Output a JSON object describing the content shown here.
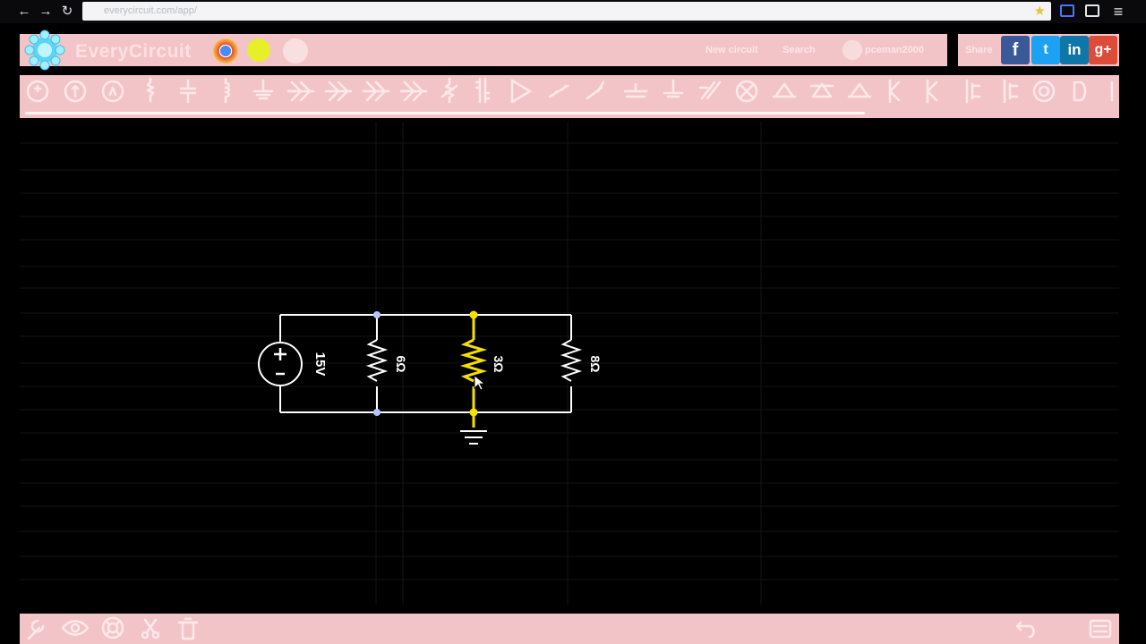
{
  "browser": {
    "url": "everycircuit.com/app/",
    "back_icon": "back-arrow-icon",
    "forward_icon": "forward-arrow-icon",
    "reload_icon": "reload-icon",
    "bookmark_icon": "star-icon"
  },
  "header": {
    "brand": "EveryCircuit",
    "new_circuit": "New circuit",
    "search": "Search",
    "username": "pceman2000",
    "share": "Share",
    "social": [
      "f",
      "t",
      "in",
      "g+"
    ]
  },
  "toolbar": {
    "components": [
      "voltage-source",
      "current-source",
      "ammeter",
      "resistor",
      "capacitor",
      "inductor",
      "ground",
      "diode",
      "zener-diode",
      "led",
      "photodiode",
      "switch",
      "transformer",
      "opamp",
      "pushbutton",
      "spdt-switch",
      "potentiometer",
      "vcvs",
      "lamp",
      "npn",
      "pnp",
      "nmos",
      "pmos",
      "nmos4",
      "pmos4",
      "wire",
      "logic-gate"
    ]
  },
  "circuit": {
    "source_label": "15V",
    "resistors": [
      {
        "label": "6Ω",
        "selected": false
      },
      {
        "label": "3Ω",
        "selected": true
      },
      {
        "label": "8Ω",
        "selected": false
      }
    ]
  },
  "bottombar": {
    "tools": [
      "wrench-icon",
      "eye-icon",
      "lifesaver-icon",
      "scissors-icon",
      "trash-icon"
    ],
    "right_tools": [
      "undo-icon",
      "fullscreen-icon"
    ]
  },
  "colors": {
    "panel": "#f3c4c7",
    "wire": "#ffffff",
    "selected": "#f7e000",
    "node_blue": "#5b6fd6",
    "facebook": "#3b5998",
    "twitter": "#1da1f2",
    "linkedin": "#0e76a8",
    "googleplus": "#dd4b39"
  }
}
